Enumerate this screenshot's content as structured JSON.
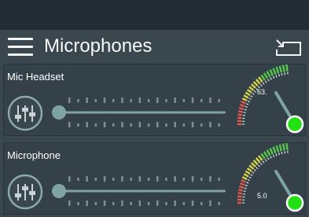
{
  "header": {
    "title": "Microphones",
    "menu_icon": "hamburger-menu-icon",
    "exit_icon": "exit-arrow-icon"
  },
  "devices": [
    {
      "name": "Mic Headset",
      "level": 0.0,
      "meter_value": "63.",
      "eq_icon": "equalizer-icon"
    },
    {
      "name": "Microphone",
      "level": 0.0,
      "meter_value": "5.0",
      "eq_icon": "equalizer-icon"
    }
  ],
  "colors": {
    "accent": "#7fa3a3",
    "knob_green": "#22e011",
    "meter_red": "#e25a4e",
    "meter_yellow": "#d8d64a",
    "meter_green": "#56c94a"
  }
}
